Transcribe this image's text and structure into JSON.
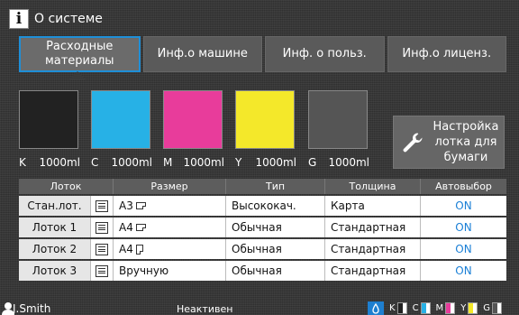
{
  "header": {
    "title": "О системе"
  },
  "tabs": [
    {
      "label": "Расходные материалы",
      "active": true
    },
    {
      "label": "Инф.о машине",
      "active": false
    },
    {
      "label": "Инф. о польз.",
      "active": false
    },
    {
      "label": "Инф.о лиценз.",
      "active": false
    }
  ],
  "inks": [
    {
      "code": "K",
      "amount": "1000ml",
      "color": "#222222"
    },
    {
      "code": "C",
      "amount": "1000ml",
      "color": "#27b1e6"
    },
    {
      "code": "M",
      "amount": "1000ml",
      "color": "#e83c9b"
    },
    {
      "code": "Y",
      "amount": "1000ml",
      "color": "#f4e82a"
    },
    {
      "code": "G",
      "amount": "1000ml",
      "color": "#555555"
    }
  ],
  "tray_button": {
    "label": "Настройка лотка для бумаги"
  },
  "table": {
    "headers": {
      "tray": "Лоток",
      "size": "Размер",
      "type": "Тип",
      "thickness": "Толщина",
      "auto": "Автовыбор"
    },
    "rows": [
      {
        "tray": "Стан.лот.",
        "size": "A3",
        "orientation": "landscape",
        "type": "Высококач.",
        "thickness": "Карта",
        "auto": "ON"
      },
      {
        "tray": "Лоток 1",
        "size": "A4",
        "orientation": "landscape",
        "type": "Обычная",
        "thickness": "Стандартная",
        "auto": "ON"
      },
      {
        "tray": "Лоток 2",
        "size": "A4",
        "orientation": "portrait",
        "type": "Обычная",
        "thickness": "Стандартная",
        "auto": "ON"
      },
      {
        "tray": "Лоток 3",
        "size": "Вручную",
        "orientation": "none",
        "type": "Обычная",
        "thickness": "Стандартная",
        "auto": "ON"
      }
    ]
  },
  "status": {
    "user": "J.Smith",
    "state": "Неактивен",
    "ink_levels": [
      {
        "code": "K",
        "color": "#222222"
      },
      {
        "code": "C",
        "color": "#27b1e6"
      },
      {
        "code": "M",
        "color": "#e83c9b"
      },
      {
        "code": "Y",
        "color": "#f4e82a"
      },
      {
        "code": "G",
        "color": "#555555"
      }
    ]
  }
}
